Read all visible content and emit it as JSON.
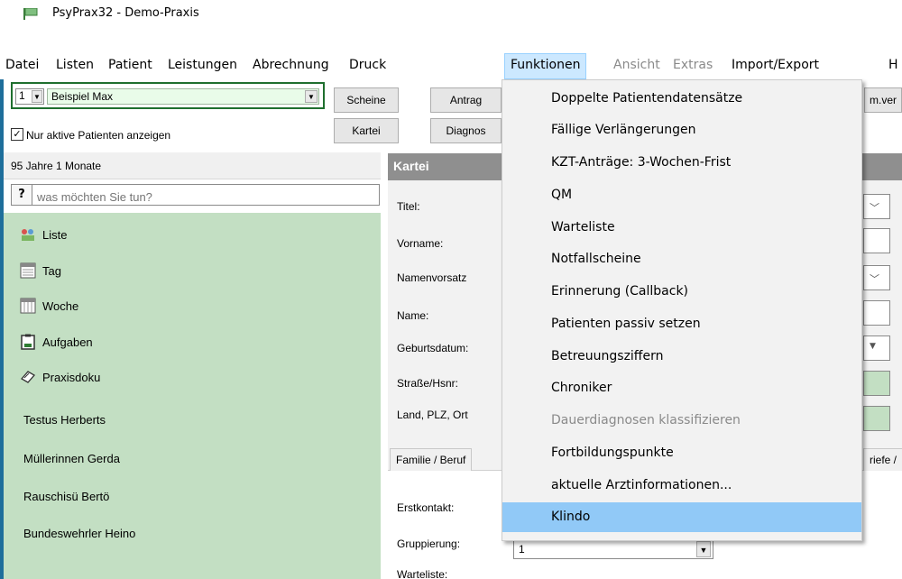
{
  "window": {
    "title": "PsyPrax32 - Demo-Praxis"
  },
  "menu": {
    "items": [
      {
        "label": "Datei",
        "state": "normal"
      },
      {
        "label": "Listen",
        "state": "normal"
      },
      {
        "label": "Patient",
        "state": "normal"
      },
      {
        "label": "Leistungen",
        "state": "normal"
      },
      {
        "label": "Abrechnung",
        "state": "normal"
      },
      {
        "label": "Druck",
        "state": "normal"
      },
      {
        "label": "Funktionen",
        "state": "active"
      },
      {
        "label": "Ansicht",
        "state": "disabled"
      },
      {
        "label": "Extras",
        "state": "disabled"
      },
      {
        "label": "Import/Export",
        "state": "normal"
      },
      {
        "label": "H",
        "state": "normal"
      }
    ]
  },
  "dropdown": {
    "items": [
      {
        "label": "Doppelte Patientendatensätze",
        "state": "normal"
      },
      {
        "label": "Fällige Verlängerungen",
        "state": "normal"
      },
      {
        "label": "KZT-Anträge: 3-Wochen-Frist",
        "state": "normal"
      },
      {
        "label": "QM",
        "state": "normal"
      },
      {
        "label": "Warteliste",
        "state": "normal"
      },
      {
        "label": "Notfallscheine",
        "state": "normal"
      },
      {
        "label": "Erinnerung (Callback)",
        "state": "normal"
      },
      {
        "label": "Patienten passiv setzen",
        "state": "normal"
      },
      {
        "label": "Betreuungsziffern",
        "state": "normal"
      },
      {
        "label": "Chroniker",
        "state": "normal"
      },
      {
        "label": "Dauerdiagnosen klassifizieren",
        "state": "disabled"
      },
      {
        "label": "Fortbildungspunkte",
        "state": "normal"
      },
      {
        "label": "aktuelle Arztinformationen...",
        "state": "normal"
      },
      {
        "label": "Klindo",
        "state": "highlighted"
      }
    ]
  },
  "patient_selector": {
    "number": "1",
    "name": "Beispiel Max"
  },
  "active_filter": {
    "label": "Nur aktive Patienten anzeigen",
    "checked": true
  },
  "age": "95 Jahre 1 Monate",
  "search": {
    "button": "?",
    "placeholder": "was möchten Sie tun?"
  },
  "nav": {
    "items": [
      {
        "label": "Liste",
        "icon": "list-icon"
      },
      {
        "label": "Tag",
        "icon": "calendar-day-icon"
      },
      {
        "label": "Woche",
        "icon": "calendar-week-icon"
      },
      {
        "label": "Aufgaben",
        "icon": "clipboard-icon"
      },
      {
        "label": "Praxisdoku",
        "icon": "document-icon"
      }
    ]
  },
  "patients": [
    "Testus Herberts",
    "Müllerinnen Gerda",
    "Rauschisü Bertö",
    "Bundeswehrler Heino"
  ],
  "toolbar": {
    "row1": [
      "Scheine",
      "Antrag",
      "m.ver"
    ],
    "row2": [
      "Kartei",
      "Diagnos"
    ]
  },
  "kartei": {
    "title": "Kartei",
    "fields": [
      "Titel:",
      "Vorname:",
      "Namenvorsatz",
      "Name:",
      "Geburtsdatum:",
      "Straße/Hsnr:",
      "Land, PLZ, Ort"
    ]
  },
  "tabs": [
    "Familie / Beruf",
    "riefe /"
  ],
  "lower_form": {
    "erstkontakt_label": "Erstkontakt:",
    "gruppierung_label": "Gruppierung:",
    "gruppierung_value": "1",
    "warteliste_label": "Warteliste:"
  },
  "colors": {
    "panel_green": "#c3dfc3",
    "menu_highlight": "#91c9f7",
    "menu_active": "#cce8ff",
    "kartei_header": "#8f8f8f"
  }
}
